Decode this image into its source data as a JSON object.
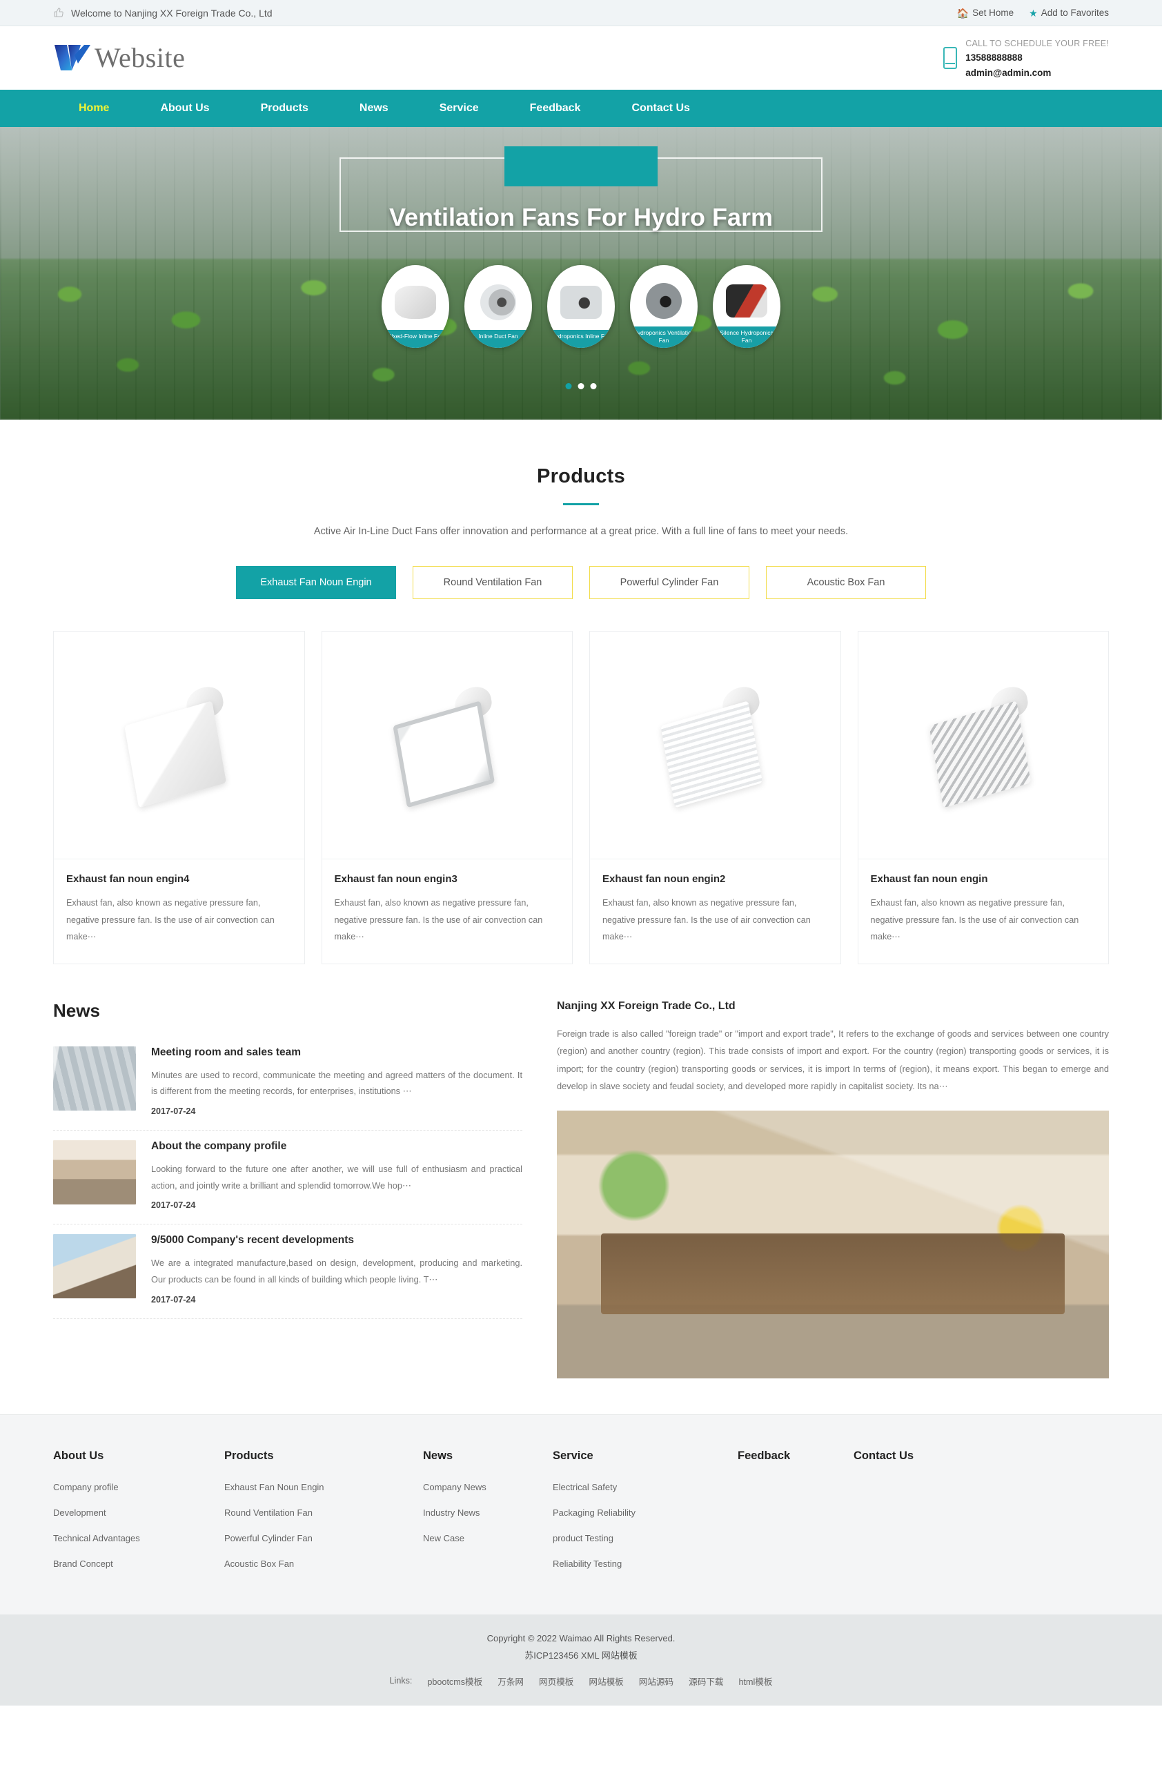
{
  "topbar": {
    "welcome": "Welcome to Nanjing XX Foreign Trade Co., Ltd",
    "thumb_icon": "thumbs-up-icon",
    "set_home": "Set Home",
    "set_home_icon": "home-icon",
    "add_favorites": "Add to Favorites",
    "add_favorites_icon": "star-icon"
  },
  "header": {
    "logo_text": "Website",
    "logo_icon": "w-logo-mark",
    "phone_icon": "mobile-phone-icon",
    "call_label": "CALL TO SCHEDULE YOUR FREE!",
    "phone": "13588888888",
    "email": "admin@admin.com"
  },
  "nav": {
    "items": [
      {
        "label": "Home",
        "active": true
      },
      {
        "label": "About Us",
        "active": false
      },
      {
        "label": "Products",
        "active": false
      },
      {
        "label": "News",
        "active": false
      },
      {
        "label": "Service",
        "active": false
      },
      {
        "label": "Feedback",
        "active": false
      },
      {
        "label": "Contact Us",
        "active": false
      }
    ]
  },
  "hero": {
    "title": "Ventilation Fans For Hydro Farm",
    "fans": [
      {
        "label": "Mixed-Flow Inline Fan"
      },
      {
        "label": "Inline Duct Fan"
      },
      {
        "label": "Hydroponics Inline Fan"
      },
      {
        "label": "Hydroponics Ventilation Fan"
      },
      {
        "label": "Silence Hydroponics Fan"
      }
    ],
    "dots": [
      true,
      false,
      false
    ]
  },
  "products": {
    "title": "Products",
    "description": "Active Air In-Line Duct Fans offer innovation and performance at a great price. With a full line of fans to meet your needs.",
    "tabs": [
      {
        "label": "Exhaust Fan Noun Engin",
        "active": true
      },
      {
        "label": "Round Ventilation Fan",
        "active": false
      },
      {
        "label": "Powerful Cylinder Fan",
        "active": false
      },
      {
        "label": "Acoustic Box Fan",
        "active": false
      }
    ],
    "cards": [
      {
        "title": "Exhaust fan noun engin4",
        "text": "Exhaust fan, also known as negative pressure fan, negative pressure fan. Is the use of air convection can make⋯"
      },
      {
        "title": "Exhaust fan noun engin3",
        "text": "Exhaust fan, also known as negative pressure fan, negative pressure fan. Is the use of air convection can make⋯"
      },
      {
        "title": "Exhaust fan noun engin2",
        "text": "Exhaust fan, also known as negative pressure fan, negative pressure fan. Is the use of air convection can make⋯"
      },
      {
        "title": "Exhaust fan noun engin",
        "text": "Exhaust fan, also known as negative pressure fan, negative pressure fan. Is the use of air convection can make⋯"
      }
    ]
  },
  "news": {
    "title": "News",
    "items": [
      {
        "title": "Meeting room and sales team",
        "text": "Minutes are used to record, communicate the meeting and agreed matters of the document. It is different from the meeting records, for enterprises, institutions ⋯",
        "date": "2017-07-24"
      },
      {
        "title": "About the company profile",
        "text": "Looking forward to the future one after another, we will use full of enthusiasm and practical action, and jointly write a brilliant and splendid tomorrow.We hop⋯",
        "date": "2017-07-24"
      },
      {
        "title": "9/5000 Company's recent developments",
        "text": "We are a integrated manufacture,based on design, development, producing and marketing. Our products can be found in all kinds of building which people living. T⋯",
        "date": "2017-07-24"
      }
    ]
  },
  "about": {
    "title": "Nanjing XX Foreign Trade Co., Ltd",
    "text": "Foreign trade is also called \"foreign trade\" or \"import and export trade\", It refers to the exchange of goods and services between one country (region) and another country (region). This trade consists of import and export. For the country (region) transporting goods or services, it is import; for the country (region) transporting goods or services, it is import In terms of (region), it means export. This began to emerge and develop in slave society and feudal society, and developed more rapidly in capitalist society. Its na⋯"
  },
  "footer": {
    "columns": [
      {
        "title": "About Us",
        "links": [
          "Company profile",
          "Development",
          "Technical Advantages",
          "Brand Concept"
        ]
      },
      {
        "title": "Products",
        "links": [
          "Exhaust Fan Noun Engin",
          "Round Ventilation Fan",
          "Powerful Cylinder Fan",
          "Acoustic Box Fan"
        ]
      },
      {
        "title": "News",
        "links": [
          "Company News",
          "Industry News",
          "New Case"
        ]
      },
      {
        "title": "Service",
        "links": [
          "Electrical Safety",
          "Packaging Reliability",
          "product Testing",
          "Reliability Testing"
        ]
      },
      {
        "title": "Feedback",
        "links": []
      },
      {
        "title": "Contact Us",
        "links": []
      }
    ],
    "copyright": "Copyright © 2022 Waimao All Rights Reserved.",
    "icp": "苏ICP123456 XML 网站模板",
    "links_label": "Links:",
    "links": [
      "pbootcms模板",
      "万条网",
      "网页模板",
      "网站模板",
      "网站源码",
      "源码下载",
      "html模板"
    ]
  },
  "colors": {
    "teal": "#13a2a6",
    "yellow": "#f2dc4a",
    "nav_active": "#f2f533"
  }
}
